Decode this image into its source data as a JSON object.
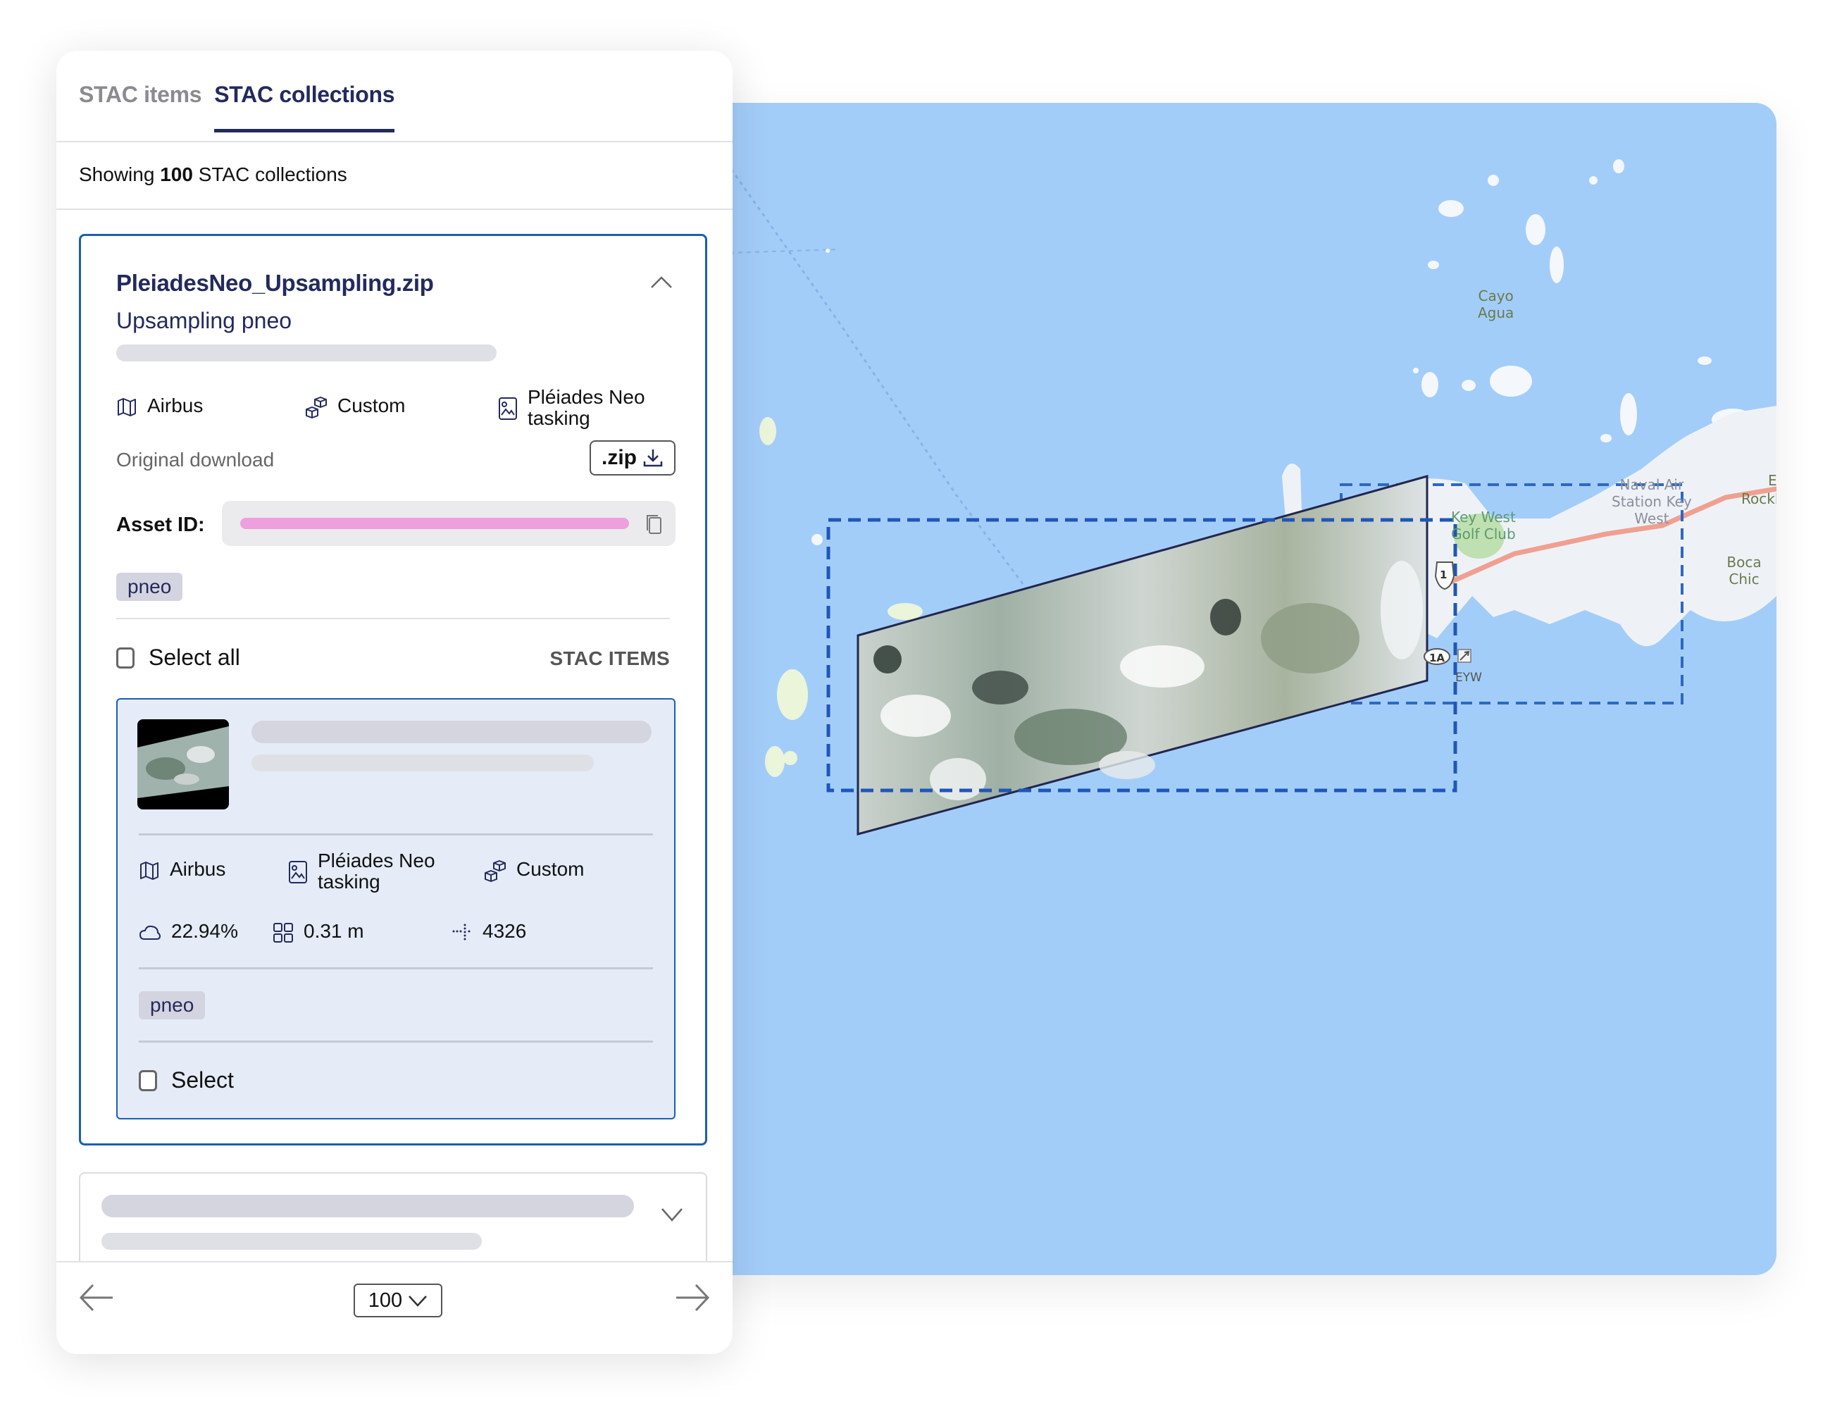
{
  "tabs": [
    {
      "label": "STAC items",
      "active": false
    },
    {
      "label": "STAC collections",
      "active": true
    }
  ],
  "summary": {
    "prefix": "Showing",
    "count": "100",
    "suffix": "STAC collections"
  },
  "collection": {
    "title": "PleiadesNeo_Upsampling.zip",
    "subtitle": "Upsampling pneo",
    "expanded": true,
    "meta": {
      "provider": "Airbus",
      "license": "Custom",
      "source_line1": "Pléiades Neo",
      "source_line2": "tasking"
    },
    "download": {
      "label": "Original download",
      "button_label": ".zip"
    },
    "asset_id_label": "Asset ID:",
    "tag": "pneo",
    "select_all_label": "Select all",
    "stac_items_label": "STAC ITEMS",
    "item": {
      "provider": "Airbus",
      "source_line1": "Pléiades Neo",
      "source_line2": "tasking",
      "license": "Custom",
      "cloud_cover": "22.94%",
      "resolution": "0.31 m",
      "epsg": "4326",
      "tag": "pneo",
      "select_label": "Select"
    }
  },
  "pagination": {
    "page_size": "100"
  },
  "map": {
    "labels": {
      "cayo_agua": [
        "Cayo",
        "Agua"
      ],
      "key_west_golf": [
        "Key West",
        "Golf Club"
      ],
      "naval_air": [
        "Naval Air",
        "Station Key",
        "West"
      ],
      "boca_chica": "Boca Chic",
      "rockland": "Rockl",
      "e_label": "E",
      "us1": "1",
      "route_1a": "1A",
      "eyw": "EYW"
    },
    "colors": {
      "water": "#a3cdf9",
      "footprint_dashed": "#1f56b8",
      "land": "#eef2f7",
      "road": "#f0a090"
    }
  },
  "colors": {
    "accent": "#1a5fb4",
    "title": "#232a5c",
    "asset_id_bar": "#ee9fdd",
    "tag_bg": "#d4d4e0",
    "item_bg": "#e5ecf7"
  }
}
